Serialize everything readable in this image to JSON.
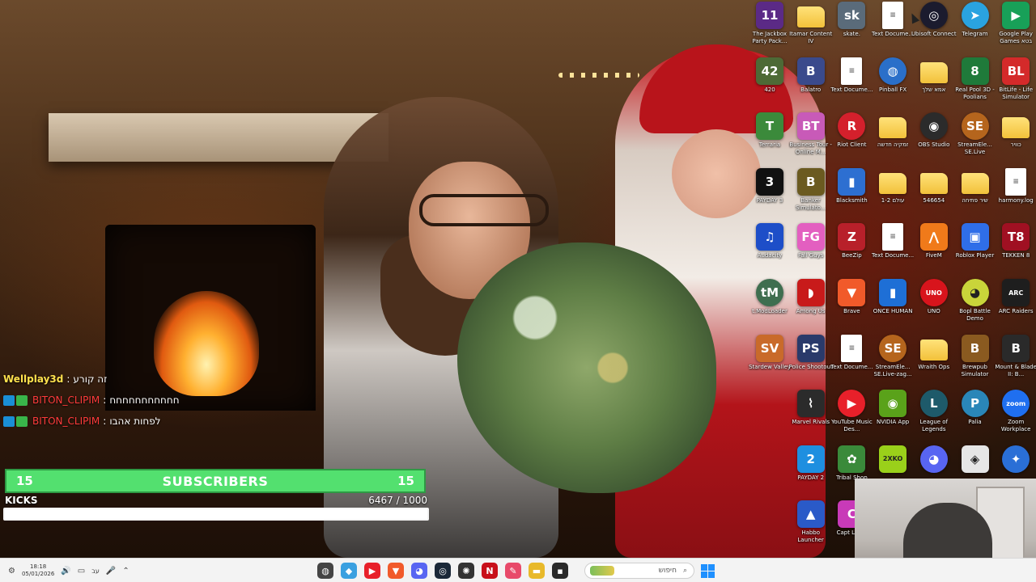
{
  "desktop": {
    "icons": [
      {
        "label": "The Jackbox Party Pack...",
        "icon": "jackbox-icon",
        "glyph": "11",
        "color": "#5b2a86"
      },
      {
        "label": "Itamar Content IV",
        "icon": "folder-icon",
        "type": "folder"
      },
      {
        "label": "skate.",
        "icon": "skate-icon",
        "glyph": "sk",
        "color": "#5a6b7a"
      },
      {
        "label": "Text Docume...",
        "icon": "text-document-icon",
        "type": "doc"
      },
      {
        "label": "Ubisoft Connect",
        "icon": "ubisoft-connect-icon",
        "glyph": "◎",
        "color": "#1b1b2e",
        "round": true
      },
      {
        "label": "Telegram",
        "icon": "telegram-icon",
        "glyph": "➤",
        "color": "#2aa3e0",
        "round": true
      },
      {
        "label": "Google Play Games בטא",
        "icon": "google-play-games-icon",
        "glyph": "▶",
        "color": "#18a058"
      },
      {
        "label": "420",
        "icon": "game-420-icon",
        "glyph": "42",
        "color": "#4d6a36"
      },
      {
        "label": "Balatro",
        "icon": "balatro-icon",
        "glyph": "B",
        "color": "#3a4a8c"
      },
      {
        "label": "Text Docume...",
        "icon": "text-document-icon",
        "type": "doc"
      },
      {
        "label": "Pinball FX",
        "icon": "pinball-fx-icon",
        "glyph": "◍",
        "color": "#2a6fc9",
        "round": true
      },
      {
        "label": "אמא שלך",
        "icon": "folder-icon",
        "type": "folder"
      },
      {
        "label": "Real Pool 3D - Poolians",
        "icon": "real-pool-icon",
        "glyph": "8",
        "color": "#1f7a3a"
      },
      {
        "label": "BitLife - Life Simulator",
        "icon": "bitlife-icon",
        "glyph": "BL",
        "color": "#d42a2a"
      },
      {
        "label": "Terraria",
        "icon": "terraria-icon",
        "glyph": "T",
        "color": "#3b8a3b"
      },
      {
        "label": "Business Tour - Online M...",
        "icon": "business-tour-icon",
        "glyph": "BT",
        "color": "#c85ab8"
      },
      {
        "label": "Riot Client",
        "icon": "riot-client-icon",
        "glyph": "R",
        "color": "#d4202c",
        "round": true
      },
      {
        "label": "זמקיה חדשה",
        "icon": "folder-icon",
        "type": "folder"
      },
      {
        "label": "OBS Studio",
        "icon": "obs-studio-icon",
        "glyph": "◉",
        "color": "#2b2b2b",
        "round": true
      },
      {
        "label": "StreamEle... SE.Live",
        "icon": "streamelements-icon",
        "glyph": "SE",
        "color": "#b5651d",
        "round": true
      },
      {
        "label": "כוויר",
        "icon": "folder-icon",
        "type": "folder"
      },
      {
        "label": "PAYDAY 3",
        "icon": "payday3-icon",
        "glyph": "3",
        "color": "#111111"
      },
      {
        "label": "Banker Simulato...",
        "icon": "banker-simulator-icon",
        "glyph": "B",
        "color": "#6b5a20"
      },
      {
        "label": "Blacksmith",
        "icon": "blacksmith-icon",
        "glyph": "▮",
        "color": "#2d6fd1"
      },
      {
        "label": "1-2 עולם",
        "icon": "folder-icon",
        "type": "folder"
      },
      {
        "label": "546654",
        "icon": "folder-icon",
        "type": "folder"
      },
      {
        "label": "שיר פתיחה",
        "icon": "folder-icon",
        "type": "folder"
      },
      {
        "label": "harmony.log",
        "icon": "log-file-icon",
        "type": "doc"
      },
      {
        "label": "Audacity",
        "icon": "audacity-icon",
        "glyph": "♫",
        "color": "#1d4ec8"
      },
      {
        "label": "Fall Guys",
        "icon": "fall-guys-icon",
        "glyph": "FG",
        "color": "#e35fc0"
      },
      {
        "label": "BeeZip",
        "icon": "beezip-icon",
        "glyph": "Z",
        "color": "#b8202a"
      },
      {
        "label": "Text Docume...",
        "icon": "text-document-icon",
        "type": "doc"
      },
      {
        "label": "FiveM",
        "icon": "fivem-icon",
        "glyph": "⋀",
        "color": "#f07a1a"
      },
      {
        "label": "Roblox Player",
        "icon": "roblox-icon",
        "glyph": "▣",
        "color": "#2f6ee8"
      },
      {
        "label": "TEKKEN 8",
        "icon": "tekken8-icon",
        "glyph": "T8",
        "color": "#a01022"
      },
      {
        "label": "t.ModLoader",
        "icon": "tmodloader-icon",
        "glyph": "tM",
        "color": "#3f6e4f",
        "round": true
      },
      {
        "label": "Among Us",
        "icon": "among-us-icon",
        "glyph": "◗",
        "color": "#c81a1a"
      },
      {
        "label": "Brave",
        "icon": "brave-icon",
        "glyph": "▼",
        "color": "#f15a2a"
      },
      {
        "label": "ONCE HUMAN",
        "icon": "once-human-icon",
        "glyph": "▮",
        "color": "#1e6fd6"
      },
      {
        "label": "UNO",
        "icon": "uno-icon",
        "glyph": "UNO",
        "color": "#d8141c",
        "round": true
      },
      {
        "label": "Bopl Battle Demo",
        "icon": "bopl-battle-icon",
        "glyph": "◕",
        "color": "#c9d43a",
        "round": true
      },
      {
        "label": "ARC Raiders",
        "icon": "arc-raiders-icon",
        "glyph": "ARC",
        "color": "#1e1e1e"
      },
      {
        "label": "Stardew Valley",
        "icon": "stardew-valley-icon",
        "glyph": "SV",
        "color": "#c96a2a"
      },
      {
        "label": "Police Shootout",
        "icon": "police-shootout-icon",
        "glyph": "PS",
        "color": "#2a3a6a"
      },
      {
        "label": "Text Docume...",
        "icon": "text-document-icon",
        "type": "doc"
      },
      {
        "label": "StreamEle... SE.Live-zag...",
        "icon": "streamelements-icon",
        "glyph": "SE",
        "color": "#b5651d",
        "round": true
      },
      {
        "label": "Wraith Ops",
        "icon": "folder-icon",
        "type": "folder"
      },
      {
        "label": "Brewpub Simulator",
        "icon": "brewpub-simulator-icon",
        "glyph": "B",
        "color": "#8a5a20"
      },
      {
        "label": "Mount & Blade II: B...",
        "icon": "mount-and-blade-icon",
        "glyph": "B",
        "color": "#2a2a2a"
      },
      {
        "label": "Marvel Rivals",
        "icon": "marvel-rivals-icon",
        "glyph": "⌇",
        "color": "#2b2b2b"
      },
      {
        "label": "YouTube Music Des...",
        "icon": "youtube-music-icon",
        "glyph": "▶",
        "color": "#e8202a",
        "round": true
      },
      {
        "label": "NVIDIA App",
        "icon": "nvidia-app-icon",
        "glyph": "◉",
        "color": "#5aa21a"
      },
      {
        "label": "League of Legends",
        "icon": "league-of-legends-icon",
        "glyph": "L",
        "color": "#1e5a6a",
        "round": true
      },
      {
        "label": "Palia",
        "icon": "palia-icon",
        "glyph": "P",
        "color": "#2a86b8",
        "round": true
      },
      {
        "label": "Zoom Workplace",
        "icon": "zoom-icon",
        "glyph": "zoom",
        "color": "#1f6ff0",
        "round": true
      },
      {
        "label": "PAYDAY 2",
        "icon": "payday2-icon",
        "glyph": "2",
        "color": "#1e8fe0"
      },
      {
        "label": "Tribal Shop",
        "icon": "tribal-shop-icon",
        "glyph": "✿",
        "color": "#3a8a3a"
      },
      {
        "label": "",
        "icon": "2xko-icon",
        "glyph": "2XKO",
        "color": "#9ad01a"
      },
      {
        "label": "",
        "icon": "discord-icon",
        "glyph": "◕",
        "color": "#5865f2",
        "round": true
      },
      {
        "label": "",
        "icon": "helmet-game-icon",
        "glyph": "◈",
        "color": "#e6e6e6"
      },
      {
        "label": "",
        "icon": "atom-app-icon",
        "glyph": "✦",
        "color": "#2a6fd6",
        "round": true
      },
      {
        "label": "Habbo Launcher",
        "icon": "habbo-launcher-icon",
        "glyph": "▲",
        "color": "#2a5ac8"
      },
      {
        "label": "Capt Laser",
        "icon": "capt-laser-icon",
        "glyph": "C",
        "color": "#c83ab8"
      }
    ]
  },
  "chat": {
    "messages": [
      {
        "user": "Wellplay3d",
        "separator": ":",
        "text": "זה קורע",
        "badges": 0
      },
      {
        "user": "BITON_CLIPIM",
        "separator": ":",
        "text": "חחחחחחחחחחח",
        "badges": 2
      },
      {
        "user": "BITON_CLIPIM",
        "separator": ":",
        "text": "לפחות אהבו",
        "badges": 2
      }
    ]
  },
  "subscriber_goal": {
    "left_count": "15",
    "label": "SUBSCRIBERS",
    "right_count": "15",
    "color": "#53e06f"
  },
  "kicks_goal": {
    "label": "KICKS",
    "current": "6467",
    "separator": " / ",
    "target": "1000",
    "fill_fraction": 1.0
  },
  "taskbar": {
    "clock_time": "18:18",
    "clock_date": "05/01/2026",
    "language": "עב",
    "search_placeholder": "חיפוש",
    "apps": [
      {
        "name": "chrome-icon",
        "glyph": "◍",
        "color": "#444444"
      },
      {
        "name": "vpn-app-icon",
        "glyph": "◆",
        "color": "#3aa0e0"
      },
      {
        "name": "media-player-icon",
        "glyph": "▶",
        "color": "#e8202a"
      },
      {
        "name": "brave-icon",
        "glyph": "▼",
        "color": "#f15a2a"
      },
      {
        "name": "discord-icon",
        "glyph": "◕",
        "color": "#5865f2"
      },
      {
        "name": "steam-icon",
        "glyph": "◎",
        "color": "#1b2838"
      },
      {
        "name": "chatgpt-icon",
        "glyph": "✺",
        "color": "#333333"
      },
      {
        "name": "netflix-icon",
        "glyph": "N",
        "color": "#c8101a"
      },
      {
        "name": "paint-icon",
        "glyph": "✎",
        "color": "#e84a6a"
      },
      {
        "name": "file-explorer-icon",
        "glyph": "▬",
        "color": "#e8b92a"
      },
      {
        "name": "terminal-icon",
        "glyph": "▪",
        "color": "#2a2a2a"
      }
    ]
  }
}
